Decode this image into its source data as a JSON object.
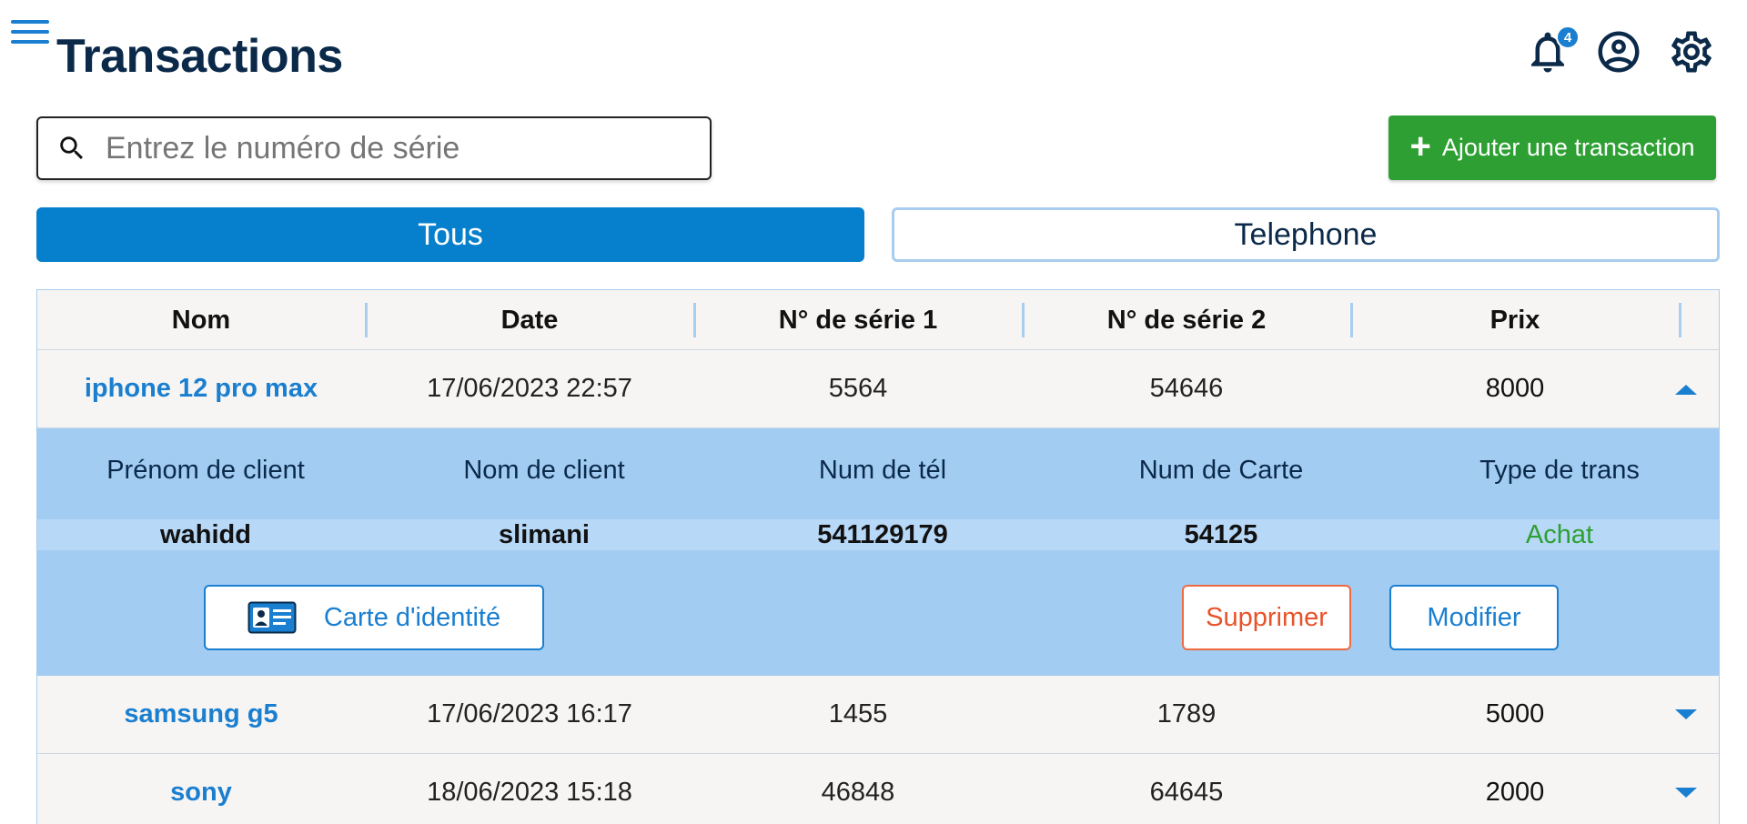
{
  "header": {
    "title": "Transactions",
    "notification_count": "4"
  },
  "search": {
    "placeholder": "Entrez le numéro de série",
    "value": ""
  },
  "actions": {
    "add_label": "Ajouter une transaction"
  },
  "filters": {
    "all_label": "Tous",
    "phone_label": "Telephone",
    "active": "Tous"
  },
  "table": {
    "columns": [
      "Nom",
      "Date",
      "N° de série 1",
      "N° de série 2",
      "Prix"
    ],
    "rows": [
      {
        "name": "iphone 12 pro max",
        "date": "17/06/2023 22:57",
        "serial1": "5564",
        "serial2": "54646",
        "price": "8000",
        "expanded": true
      },
      {
        "name": "samsung g5",
        "date": "17/06/2023 16:17",
        "serial1": "1455",
        "serial2": "1789",
        "price": "5000",
        "expanded": false
      },
      {
        "name": "sony",
        "date": "18/06/2023 15:18",
        "serial1": "46848",
        "serial2": "64645",
        "price": "2000",
        "expanded": false
      }
    ]
  },
  "detail": {
    "labels": [
      "Prénom de client",
      "Nom de client",
      "Num de tél",
      "Num de Carte",
      "Type de trans"
    ],
    "values": {
      "first_name": "wahidd",
      "last_name": "slimani",
      "phone": "541129179",
      "card": "54125",
      "type": "Achat"
    },
    "id_card_label": "Carte d'identité",
    "delete_label": "Supprimer",
    "edit_label": "Modifier"
  },
  "colors": {
    "primary": "#0680cc",
    "accent_blue": "#1a7fd0",
    "success": "#2ea033",
    "danger": "#e8532a",
    "detail_bg": "#a3ccf3",
    "title": "#0b2a4a"
  },
  "icons": [
    "menu-icon",
    "bell-icon",
    "account-circle-icon",
    "gear-icon",
    "search-icon",
    "plus-icon",
    "id-card-icon",
    "chevron-up-icon",
    "chevron-down-icon"
  ]
}
